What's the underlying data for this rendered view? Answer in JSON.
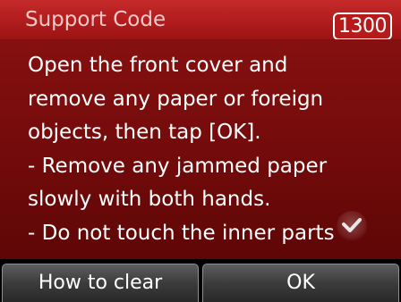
{
  "header": {
    "title": "Support Code",
    "code": "1300"
  },
  "message": {
    "lines": [
      "Open the front cover and",
      "remove any paper or foreign",
      "objects, then tap [OK].",
      "- Remove any jammed paper",
      "slowly with both hands.",
      "- Do not touch the inner parts"
    ]
  },
  "scroll_indicator": {
    "icon": "checkmark-down-icon"
  },
  "buttons": {
    "left_label": "How to clear",
    "right_label": "OK"
  },
  "colors": {
    "title_bar": "#b11c1c",
    "message_background": "#700a0a",
    "title_text": "#f3c9c9",
    "button_background": "#3c3c3c"
  }
}
